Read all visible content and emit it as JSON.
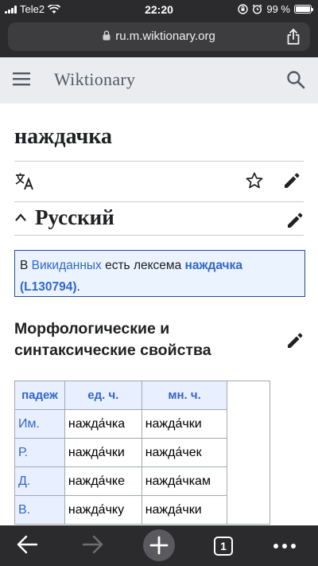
{
  "status": {
    "carrier": "Tele2",
    "time": "22:20",
    "battery": "99 %",
    "battery_level": 0.99
  },
  "browser": {
    "url": "ru.m.wiktionary.org",
    "open_tabs": "1"
  },
  "header": {
    "brand": "Wiktionary"
  },
  "page": {
    "title": "наждачка",
    "language": "Русский",
    "notice": {
      "prefix": "В ",
      "link": "Викиданных",
      "middle": " есть лексема ",
      "lexeme": "наждачка (L130794)",
      "suffix": "."
    },
    "morph_heading": "Морфологические и синтаксические свойства",
    "table": {
      "headers": [
        "падеж",
        "ед. ч.",
        "мн. ч."
      ],
      "rows": [
        [
          "Им.",
          "нажда́чка",
          "нажда́чки"
        ],
        [
          "Р.",
          "нажда́чки",
          "нажда́чек"
        ],
        [
          "Д.",
          "нажда́чке",
          "нажда́чкам"
        ],
        [
          "В.",
          "нажда́чку",
          "нажда́чки"
        ]
      ]
    }
  },
  "icons": {
    "menu": "menu-icon",
    "search": "search-icon",
    "translate": "translate-icon",
    "star": "star-icon",
    "edit": "pencil-icon",
    "chevron": "chevron-up-icon",
    "back": "arrow-left-icon",
    "forward": "arrow-right-icon",
    "new_tab": "plus-icon",
    "tabs": "tabs-icon",
    "more": "more-icon",
    "share": "share-icon",
    "lock": "lock-icon"
  },
  "colors": {
    "link": "#3366cc",
    "header_bg": "#eaecf0",
    "browser_chrome": "#2b2b2d"
  }
}
